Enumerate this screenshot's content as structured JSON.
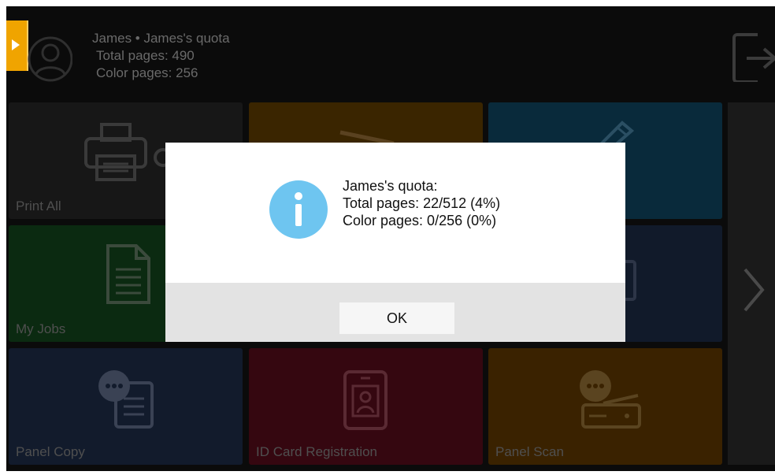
{
  "header": {
    "user_line": "James • James's quota",
    "total_pages": "Total pages: 490",
    "color_pages": "Color pages: 256"
  },
  "tiles": [
    {
      "label": "Print All",
      "icon": "printer-icon"
    },
    {
      "label": "",
      "icon": "scanner-icon"
    },
    {
      "label": "",
      "icon": "pencil-icon"
    },
    {
      "label": "My Jobs",
      "icon": "document-icon"
    },
    {
      "label": "",
      "icon": "clipboard-icon"
    },
    {
      "label": "Panel Copy",
      "icon": "copy-chat-icon"
    },
    {
      "label": "ID Card Registration",
      "icon": "id-card-icon"
    },
    {
      "label": "Panel Scan",
      "icon": "scan-chat-icon"
    }
  ],
  "dialog": {
    "title": "James's quota:",
    "total": "Total pages: 22/512 (4%)",
    "color": "Color pages: 0/256 (0%)",
    "ok_label": "OK",
    "icon": "info-icon"
  },
  "colors": {
    "accent": "#f0a400",
    "info_blue": "#6ec5f0"
  }
}
